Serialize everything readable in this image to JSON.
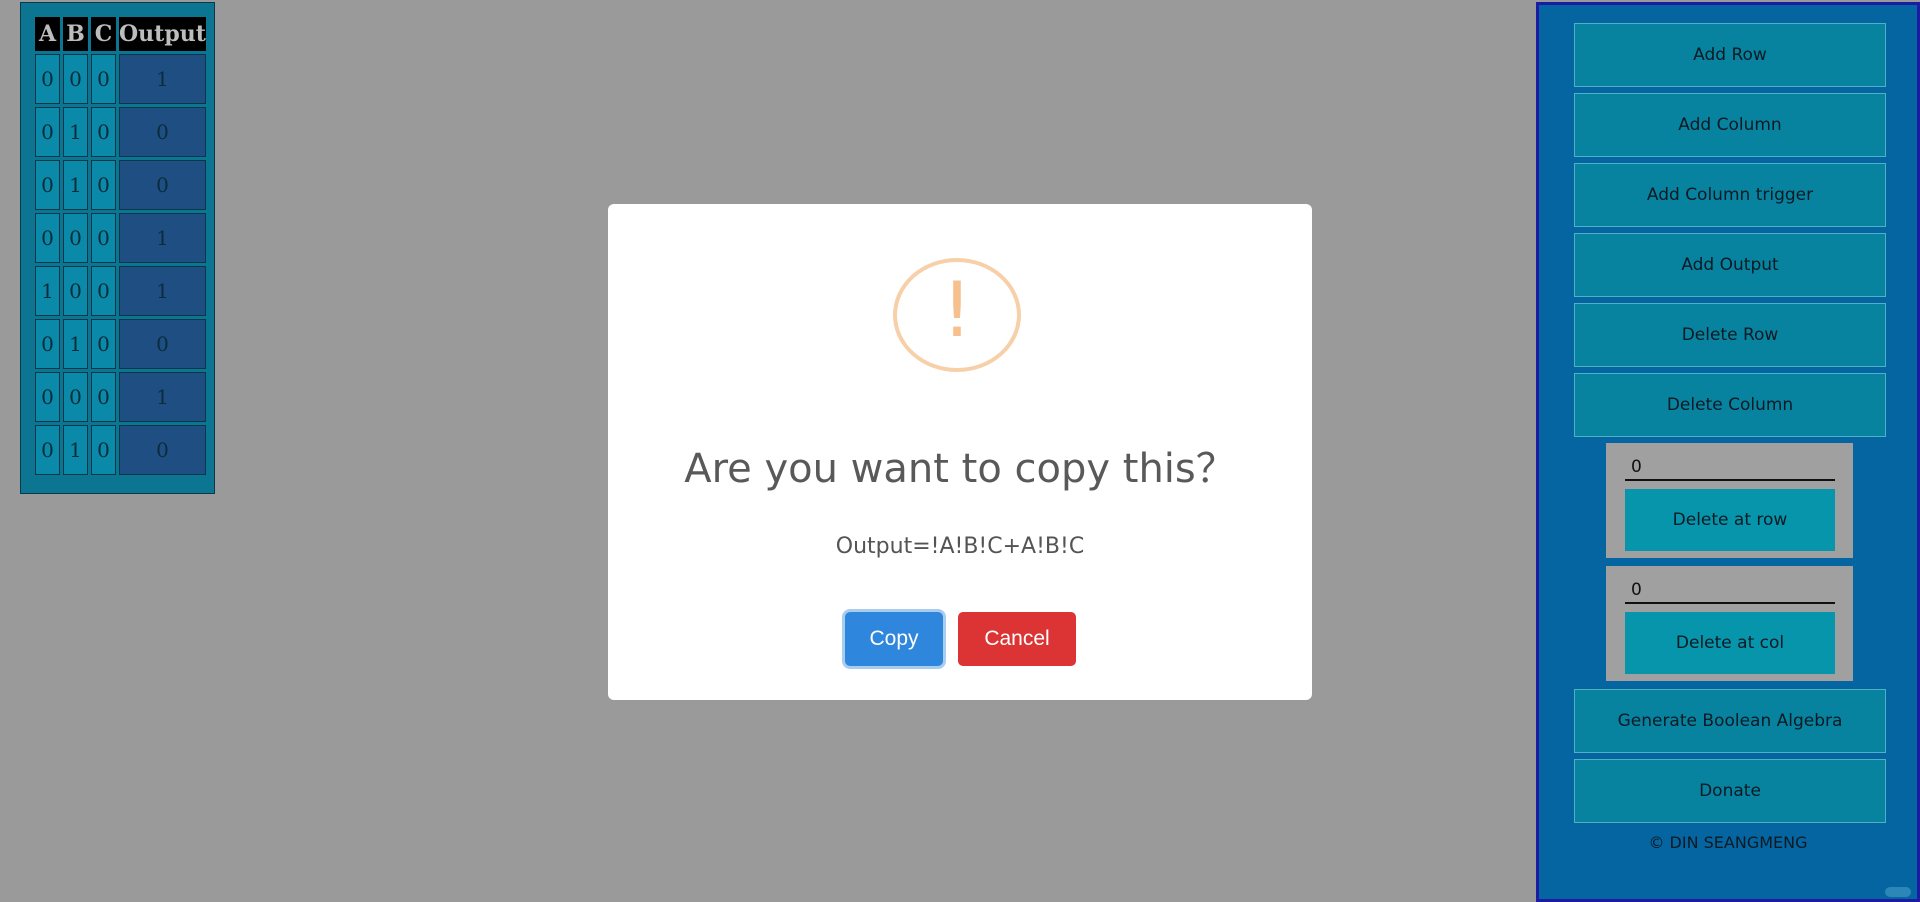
{
  "truth_table": {
    "headers": [
      "A",
      "B",
      "C",
      "Output"
    ],
    "rows": [
      [
        "0",
        "0",
        "0",
        "1"
      ],
      [
        "0",
        "1",
        "0",
        "0"
      ],
      [
        "0",
        "1",
        "0",
        "0"
      ],
      [
        "0",
        "0",
        "0",
        "1"
      ],
      [
        "1",
        "0",
        "0",
        "1"
      ],
      [
        "0",
        "1",
        "0",
        "0"
      ],
      [
        "0",
        "0",
        "0",
        "1"
      ],
      [
        "0",
        "1",
        "0",
        "0"
      ]
    ]
  },
  "sidebar": {
    "buttons": {
      "add_row": "Add Row",
      "add_column": "Add Column",
      "add_column_trigger": "Add Column trigger",
      "add_output": "Add Output",
      "delete_row": "Delete Row",
      "delete_column": "Delete Column",
      "generate_boolean_algebra": "Generate Boolean Algebra",
      "donate": "Donate"
    },
    "delete_at_row": {
      "value": "0",
      "button": "Delete at row"
    },
    "delete_at_col": {
      "value": "0",
      "button": "Delete at col"
    },
    "copyright": "© DIN SEANGMENG"
  },
  "dialog": {
    "icon": "exclamation-icon",
    "icon_glyph": "!",
    "title": "Are you want to copy this？",
    "text": "Output=!A!B!C+A!B!C",
    "copy_label": "Copy",
    "cancel_label": "Cancel"
  },
  "colors": {
    "overlay": "#9a9a9a",
    "copy_button": "#2f86dd",
    "cancel_button": "#dc3434",
    "warning_icon": "#f6c08f"
  }
}
